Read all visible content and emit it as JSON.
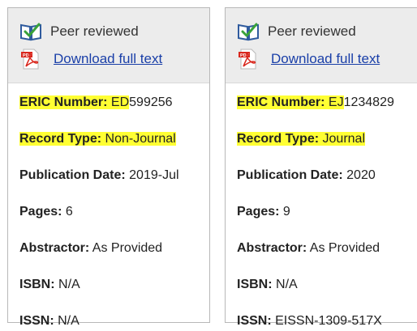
{
  "records": [
    {
      "peer_reviewed": "Peer reviewed",
      "download": "Download full text",
      "eric_number_prefix": "ED",
      "eric_number_digits": "599256",
      "fields": {
        "eric_number_label": "ERIC Number:",
        "record_type_label": "Record Type:",
        "record_type_value": "Non-Journal",
        "publication_date_label": "Publication Date:",
        "publication_date_value": "2019-Jul",
        "pages_label": "Pages:",
        "pages_value": "6",
        "abstractor_label": "Abstractor:",
        "abstractor_value": "As Provided",
        "isbn_label": "ISBN:",
        "isbn_value": "N/A",
        "issn_label": "ISSN:",
        "issn_value": "N/A"
      }
    },
    {
      "peer_reviewed": "Peer reviewed",
      "download": "Download full text",
      "eric_number_prefix": "EJ",
      "eric_number_digits": "1234829",
      "fields": {
        "eric_number_label": "ERIC Number:",
        "record_type_label": "Record Type:",
        "record_type_value": "Journal",
        "publication_date_label": "Publication Date:",
        "publication_date_value": "2020",
        "pages_label": "Pages:",
        "pages_value": "9",
        "abstractor_label": "Abstractor:",
        "abstractor_value": "As Provided",
        "isbn_label": "ISBN:",
        "isbn_value": "N/A",
        "issn_label": "ISSN:",
        "issn_value": "EISSN-1309-517X"
      }
    }
  ],
  "colors": {
    "highlight": "#ffff33",
    "link": "#1a3fa8",
    "header_bg": "#ececec",
    "pdf_red": "#d9261c",
    "check_green": "#3aa23a",
    "book_blue": "#2f5b9e"
  }
}
